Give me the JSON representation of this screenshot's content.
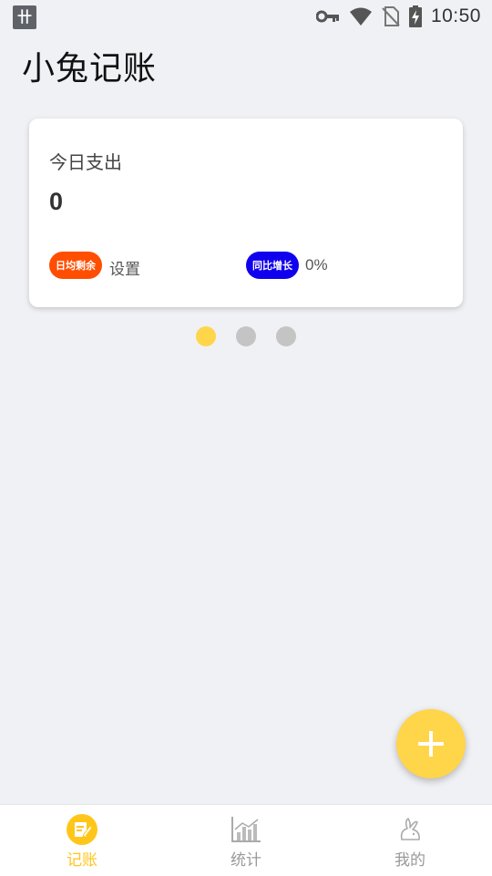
{
  "status_bar": {
    "time": "10:50",
    "icons": [
      "vpn-key-icon",
      "wifi-icon",
      "no-sim-icon",
      "battery-charging-icon"
    ],
    "notification_icon": "app-notification-icon"
  },
  "app": {
    "title": "小兔记账"
  },
  "card": {
    "title": "今日支出",
    "amount": "0",
    "daily_remaining_badge": "日均剩余",
    "settings_link": "设置",
    "yoy_growth_badge": "同比增长",
    "yoy_growth_value": "0%",
    "colors": {
      "daily_badge": "#ff4e00",
      "growth_badge": "#1100ee"
    }
  },
  "pager": {
    "count": 3,
    "active_index": 0
  },
  "fab": {
    "icon": "plus-icon",
    "color": "#ffd54a"
  },
  "bottom_nav": {
    "items": [
      {
        "label": "记账",
        "icon": "note-edit-icon",
        "active": true
      },
      {
        "label": "统计",
        "icon": "chart-icon",
        "active": false
      },
      {
        "label": "我的",
        "icon": "rabbit-icon",
        "active": false
      }
    ]
  },
  "colors": {
    "accent": "#ffd54a",
    "background": "#f0f1f5"
  }
}
